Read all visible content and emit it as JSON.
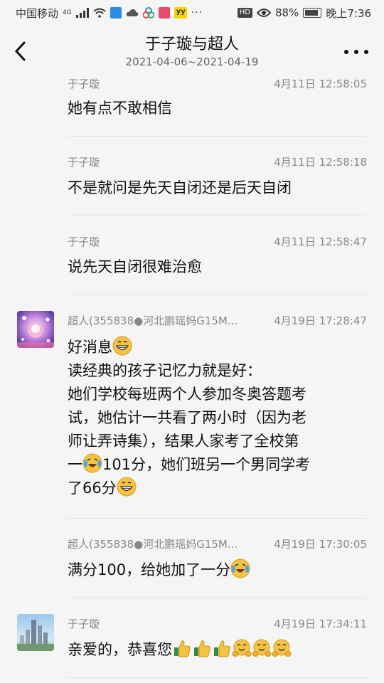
{
  "status_bar": {
    "carrier": "中国移动",
    "network": "4G",
    "hd": "HD",
    "battery": "88%",
    "time": "晚上7:36",
    "icons": [
      "signal-icon",
      "wifi-icon",
      "app-icon",
      "cloud-icon",
      "app-icon",
      "app-icon",
      "app-icon",
      "more-notifications-icon",
      "eye-icon",
      "battery-icon"
    ]
  },
  "header": {
    "title": "于子璇与超人",
    "date_range": "2021-04-06~2021-04-19"
  },
  "messages": [
    {
      "sender": "于子璇",
      "time": "4月11日 12:58:05",
      "text": "她有点不敢相信"
    },
    {
      "sender": "于子璇",
      "time": "4月11日 12:58:18",
      "text": "不是就问是先天自闭还是后天自闭"
    },
    {
      "sender": "于子璇",
      "time": "4月11日 12:58:47",
      "text": "说先天自闭很难治愈"
    },
    {
      "sender": "超人(355838●河北鹏瑶妈G15M...",
      "time": "4月19日 17:28:47",
      "lines": [
        "好消息",
        "读经典的孩子记忆力就是好：",
        "她们学校每班两个人参加冬奥答题考",
        "试，她估计一共看了两小时（因为老",
        "师让弄诗集），结果人家考了全校第",
        "一",
        "101分，她们班另一个男同学考",
        "了66分"
      ],
      "emoji": [
        "grin-emoji",
        "laugh-cry-emoji",
        "grin-emoji"
      ]
    },
    {
      "sender": "超人(355838●河北鹏瑶妈G15M...",
      "time": "4月19日 17:30:05",
      "text": "满分100，给她加了一分",
      "emoji": [
        "laugh-cry-emoji"
      ]
    },
    {
      "sender": "于子璇",
      "time": "4月19日 17:34:11",
      "text": "亲爱的，恭喜您",
      "emoji": [
        "thumbs-up-emoji",
        "thumbs-up-emoji",
        "thumbs-up-emoji",
        "hug-emoji",
        "hug-emoji",
        "hug-emoji"
      ]
    }
  ],
  "colors": {
    "background": "#f5f5f5",
    "divider": "#e3e3e3",
    "meta_text": "#888888",
    "emoji_yellow": "#f6c343"
  }
}
